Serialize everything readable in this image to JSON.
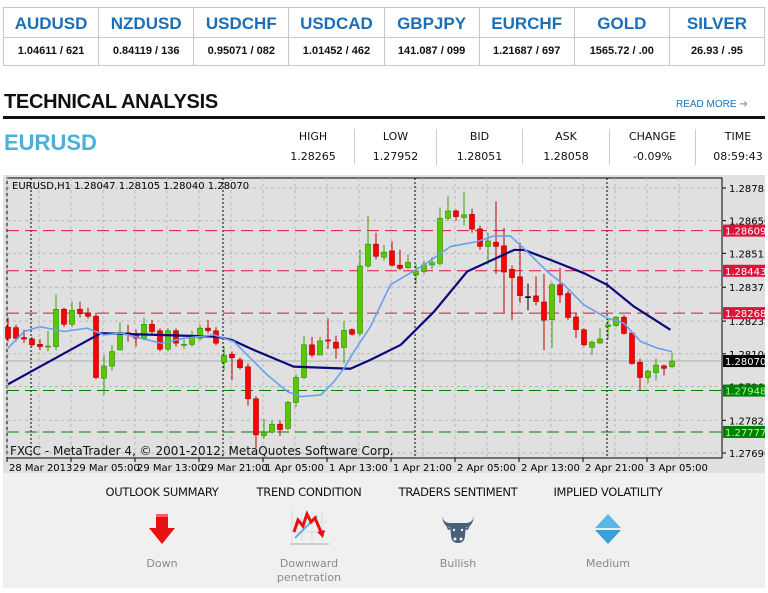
{
  "ticker": [
    {
      "symbol": "AUDUSD",
      "quote": "1.04611 / 621"
    },
    {
      "symbol": "NZDUSD",
      "quote": "0.84119 / 136"
    },
    {
      "symbol": "USDCHF",
      "quote": "0.95071 / 082"
    },
    {
      "symbol": "USDCAD",
      "quote": "1.01452 / 462"
    },
    {
      "symbol": "GBPJPY",
      "quote": "141.087 / 099"
    },
    {
      "symbol": "EURCHF",
      "quote": "1.21687 / 697"
    },
    {
      "symbol": "GOLD",
      "quote": "1565.72 / .00"
    },
    {
      "symbol": "SILVER",
      "quote": "26.93 / .95"
    }
  ],
  "section": {
    "title": "TECHNICAL ANALYSIS",
    "read_more": "READ MORE",
    "read_more_icon": "arrow-right-icon"
  },
  "instrument": {
    "symbol": "EURUSD",
    "stats": [
      {
        "label": "HIGH",
        "value": "1.28265"
      },
      {
        "label": "LOW",
        "value": "1.27952"
      },
      {
        "label": "BID",
        "value": "1.28051"
      },
      {
        "label": "ASK",
        "value": "1.28058"
      },
      {
        "label": "CHANGE",
        "value": "-0.09%"
      },
      {
        "label": "TIME",
        "value": "08:59:43"
      }
    ]
  },
  "chart_data": {
    "type": "candlestick",
    "header": "EURUSD,H1  1.28047 1.28105 1.28040 1.28070",
    "watermark": "FXCC - MetaTrader 4, © 2001-2012, MetaQuotes Software Corp.",
    "ylim": [
      1.2769,
      1.28785
    ],
    "y_ticks": [
      "1.28785",
      "1.28650",
      "1.28515",
      "1.28375",
      "1.28235",
      "1.28100",
      "1.27965",
      "1.27825",
      "1.27690"
    ],
    "x_ticks": [
      "28 Mar 2013",
      "29 Mar 05:00",
      "29 Mar 13:00",
      "29 Mar 21:00",
      "1 Apr 05:00",
      "1 Apr 13:00",
      "1 Apr 21:00",
      "2 Apr 05:00",
      "2 Apr 13:00",
      "2 Apr 21:00",
      "3 Apr 05:00"
    ],
    "grid": true,
    "colors": {
      "bull": "#5ac800",
      "bear": "#ff0000",
      "fast_ma": "#6a9ff0",
      "slow_ma": "#0a0a7a",
      "resistance": "#dc143c",
      "support": "#008000"
    },
    "levels": [
      {
        "price": "1.28609",
        "kind": "resistance"
      },
      {
        "price": "1.28443",
        "kind": "resistance"
      },
      {
        "price": "1.28268",
        "kind": "resistance"
      },
      {
        "price": "1.28070",
        "kind": "current"
      },
      {
        "price": "1.27948",
        "kind": "support"
      },
      {
        "price": "1.27777",
        "kind": "support"
      }
    ],
    "ohlc": [
      [
        1.2821,
        1.2825,
        1.2815,
        1.28164
      ],
      [
        1.28208,
        1.2822,
        1.2815,
        1.28164
      ],
      [
        1.28167,
        1.282,
        1.28145,
        1.28161
      ],
      [
        1.28161,
        1.2817,
        1.2813,
        1.28137
      ],
      [
        1.28139,
        1.2816,
        1.28115,
        1.2813
      ],
      [
        1.2813,
        1.28195,
        1.2811,
        1.28132
      ],
      [
        1.2813,
        1.28345,
        1.28115,
        1.28284
      ],
      [
        1.28284,
        1.2829,
        1.2821,
        1.28222
      ],
      [
        1.28222,
        1.28315,
        1.2821,
        1.2828
      ],
      [
        1.28284,
        1.28315,
        1.2825,
        1.28266
      ],
      [
        1.28269,
        1.2829,
        1.28245,
        1.28255
      ],
      [
        1.28255,
        1.2827,
        1.27995,
        1.28002
      ],
      [
        1.27999,
        1.28095,
        1.2793,
        1.28049
      ],
      [
        1.28049,
        1.28135,
        1.2803,
        1.28109
      ],
      [
        1.28116,
        1.2823,
        1.28116,
        1.28189
      ],
      [
        1.28187,
        1.2822,
        1.2815,
        1.28184
      ],
      [
        1.28175,
        1.282,
        1.2813,
        1.28164
      ],
      [
        1.28164,
        1.2825,
        1.28155,
        1.28222
      ],
      [
        1.28222,
        1.2824,
        1.2818,
        1.28192
      ],
      [
        1.28195,
        1.28205,
        1.2811,
        1.28119
      ],
      [
        1.28119,
        1.28205,
        1.2811,
        1.28195
      ],
      [
        1.28195,
        1.28205,
        1.2813,
        1.28144
      ],
      [
        1.28137,
        1.2816,
        1.2812,
        1.28139
      ],
      [
        1.28139,
        1.28195,
        1.2813,
        1.28167
      ],
      [
        1.28164,
        1.2822,
        1.28155,
        1.28206
      ],
      [
        1.28206,
        1.2824,
        1.28185,
        1.28196
      ],
      [
        1.28195,
        1.2821,
        1.28135,
        1.28144
      ],
      [
        1.28065,
        1.2813,
        1.2803,
        1.28093
      ],
      [
        1.28098,
        1.2811,
        1.2799,
        1.28084
      ],
      [
        1.28075,
        1.28085,
        1.28035,
        1.28043
      ],
      [
        1.28046,
        1.2806,
        1.27885,
        1.27914
      ],
      [
        1.27914,
        1.27925,
        1.2771,
        1.27765
      ],
      [
        1.27762,
        1.2783,
        1.2775,
        1.27776
      ],
      [
        1.27776,
        1.27825,
        1.2777,
        1.27809
      ],
      [
        1.27809,
        1.27825,
        1.2776,
        1.27787
      ],
      [
        1.27792,
        1.27905,
        1.27785,
        1.27899
      ],
      [
        1.27899,
        1.28015,
        1.2788,
        1.28002
      ],
      [
        1.28002,
        1.28175,
        1.27995,
        1.28137
      ],
      [
        1.28137,
        1.2817,
        1.28085,
        1.28095
      ],
      [
        1.28095,
        1.2817,
        1.28095,
        1.28153
      ],
      [
        1.28157,
        1.28245,
        1.2812,
        1.28153
      ],
      [
        1.28148,
        1.28175,
        1.2808,
        1.28123
      ],
      [
        1.28126,
        1.28235,
        1.2806,
        1.28197
      ],
      [
        1.282,
        1.28205,
        1.28175,
        1.28181
      ],
      [
        1.28185,
        1.2853,
        1.28175,
        1.28463
      ],
      [
        1.28463,
        1.2867,
        1.28455,
        1.28553
      ],
      [
        1.28553,
        1.286,
        1.2849,
        1.28503
      ],
      [
        1.28499,
        1.2855,
        1.28485,
        1.2852
      ],
      [
        1.28525,
        1.28565,
        1.2846,
        1.28466
      ],
      [
        1.28466,
        1.2853,
        1.28445,
        1.28453
      ],
      [
        1.28456,
        1.2851,
        1.2845,
        1.28478
      ],
      [
        1.28426,
        1.2847,
        1.2839,
        1.28442
      ],
      [
        1.2844,
        1.28485,
        1.2843,
        1.28467
      ],
      [
        1.28467,
        1.285,
        1.2845,
        1.28477
      ],
      [
        1.28474,
        1.28705,
        1.28465,
        1.2866
      ],
      [
        1.2866,
        1.2875,
        1.2865,
        1.2869
      ],
      [
        1.2869,
        1.28695,
        1.2865,
        1.28667
      ],
      [
        1.28664,
        1.2877,
        1.2863,
        1.28674
      ],
      [
        1.28676,
        1.287,
        1.286,
        1.28615
      ],
      [
        1.28616,
        1.2863,
        1.2853,
        1.28544
      ],
      [
        1.28544,
        1.286,
        1.2847,
        1.28566
      ],
      [
        1.28561,
        1.2873,
        1.2843,
        1.28544
      ],
      [
        1.28546,
        1.2862,
        1.2827,
        1.28438
      ],
      [
        1.28449,
        1.28465,
        1.2824,
        1.28415
      ],
      [
        1.28418,
        1.2856,
        1.2831,
        1.2834
      ],
      [
        1.28336,
        1.2839,
        1.2828,
        1.28336
      ],
      [
        1.28339,
        1.2842,
        1.283,
        1.28316
      ],
      [
        1.28314,
        1.2843,
        1.28115,
        1.28239
      ],
      [
        1.28241,
        1.28395,
        1.28125,
        1.28385
      ],
      [
        1.28385,
        1.28455,
        1.2831,
        1.28343
      ],
      [
        1.28349,
        1.2836,
        1.2824,
        1.2825
      ],
      [
        1.28252,
        1.2827,
        1.28165,
        1.282
      ],
      [
        1.28199,
        1.28205,
        1.2813,
        1.28137
      ],
      [
        1.28127,
        1.28155,
        1.28095,
        1.28148
      ],
      [
        1.28145,
        1.28205,
        1.2814,
        1.28161
      ],
      [
        1.28212,
        1.2825,
        1.2816,
        1.28219
      ],
      [
        1.28217,
        1.28255,
        1.2821,
        1.28251
      ],
      [
        1.28251,
        1.2826,
        1.2818,
        1.28184
      ],
      [
        1.28186,
        1.2819,
        1.28055,
        1.2806
      ],
      [
        1.28065,
        1.2808,
        1.27948,
        1.28002
      ],
      [
        1.28002,
        1.28035,
        1.2798,
        1.28028
      ],
      [
        1.28022,
        1.2808,
        1.2799,
        1.28053
      ],
      [
        1.2805,
        1.28055,
        1.2801,
        1.2804
      ],
      [
        1.28047,
        1.28105,
        1.2804,
        1.2807
      ]
    ],
    "fast_ma": [
      [
        0,
        1.28123
      ],
      [
        2,
        1.28192
      ],
      [
        4,
        1.28212
      ],
      [
        7,
        1.28192
      ],
      [
        9.9,
        1.28206
      ],
      [
        12,
        1.28178
      ],
      [
        14.1,
        1.28185
      ],
      [
        19.1,
        1.28144
      ],
      [
        22,
        1.28164
      ],
      [
        25.75,
        1.28178
      ],
      [
        28.25,
        1.2815
      ],
      [
        29.9,
        1.28095
      ],
      [
        32.4,
        1.28013
      ],
      [
        34.9,
        1.27944
      ],
      [
        36.6,
        1.27923
      ],
      [
        39.1,
        1.2793
      ],
      [
        40.75,
        1.27985
      ],
      [
        42,
        1.2804
      ],
      [
        43.25,
        1.28109
      ],
      [
        45.3,
        1.28212
      ],
      [
        47.8,
        1.28385
      ],
      [
        52,
        1.28467
      ],
      [
        55.3,
        1.28543
      ],
      [
        58.7,
        1.28564
      ],
      [
        60.75,
        1.28587
      ],
      [
        62.8,
        1.28587
      ],
      [
        64.9,
        1.28522
      ],
      [
        67.4,
        1.2844
      ],
      [
        69.5,
        1.28385
      ],
      [
        72,
        1.28302
      ],
      [
        74.9,
        1.28247
      ],
      [
        77,
        1.28226
      ],
      [
        79.1,
        1.2815
      ],
      [
        81.2,
        1.28123
      ],
      [
        83,
        1.28109
      ]
    ],
    "slow_ma": [
      [
        0,
        1.27974
      ],
      [
        11.6,
        1.28185
      ],
      [
        26,
        1.28171
      ],
      [
        28,
        1.28157
      ],
      [
        30.7,
        1.28116
      ],
      [
        35.7,
        1.28047
      ],
      [
        42.8,
        1.28038
      ],
      [
        45.3,
        1.28075
      ],
      [
        49.1,
        1.28137
      ],
      [
        53.25,
        1.28274
      ],
      [
        57.4,
        1.2844
      ],
      [
        63.25,
        1.28529
      ],
      [
        64.5,
        1.28529
      ],
      [
        67.8,
        1.28488
      ],
      [
        72,
        1.28433
      ],
      [
        74.9,
        1.28385
      ],
      [
        78.25,
        1.28295
      ],
      [
        82.8,
        1.28199
      ]
    ]
  },
  "outlook": [
    {
      "title": "OUTLOOK SUMMARY",
      "value": "Down",
      "icon": "arrow-down-icon",
      "color": "#e81010"
    },
    {
      "title": "TREND CONDITION",
      "value": "Downward penetration",
      "icon": "trend-chart-icon",
      "color": "#e81010"
    },
    {
      "title": "TRADERS SENTIMENT",
      "value": "Bullish",
      "icon": "bull-icon",
      "color": "#4a6079"
    },
    {
      "title": "IMPLIED VOLATILITY",
      "value": "Medium",
      "icon": "diamond-icon",
      "color": "#3a9fd8"
    }
  ]
}
